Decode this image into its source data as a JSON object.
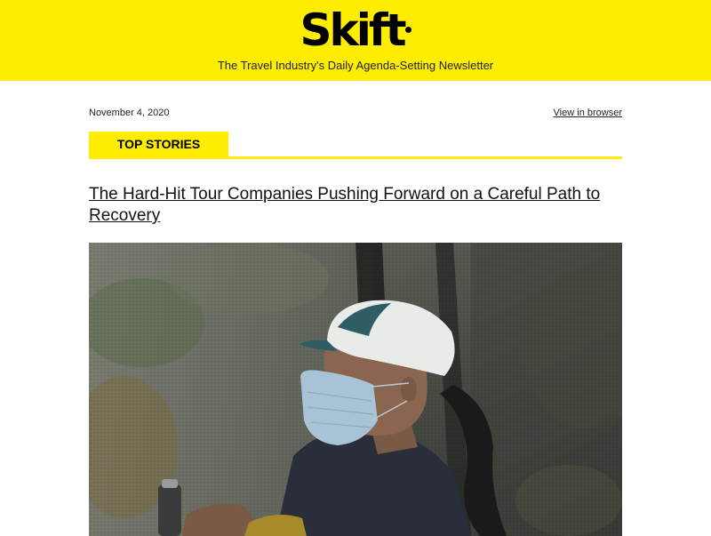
{
  "header": {
    "logo_text": "Skift",
    "tagline": "The Travel Industry's Daily Agenda-Setting Newsletter"
  },
  "meta": {
    "date": "November 4, 2020",
    "view_in_browser": "View in browser"
  },
  "section": {
    "label": "TOP STORIES"
  },
  "article": {
    "headline": "The Hard-Hit Tour Companies Pushing Forward on a Careful Path to Recovery",
    "image_subject": "masked-traveler-in-cable-car-photo"
  },
  "colors": {
    "brand_yellow": "#ffed00",
    "text": "#111111"
  }
}
